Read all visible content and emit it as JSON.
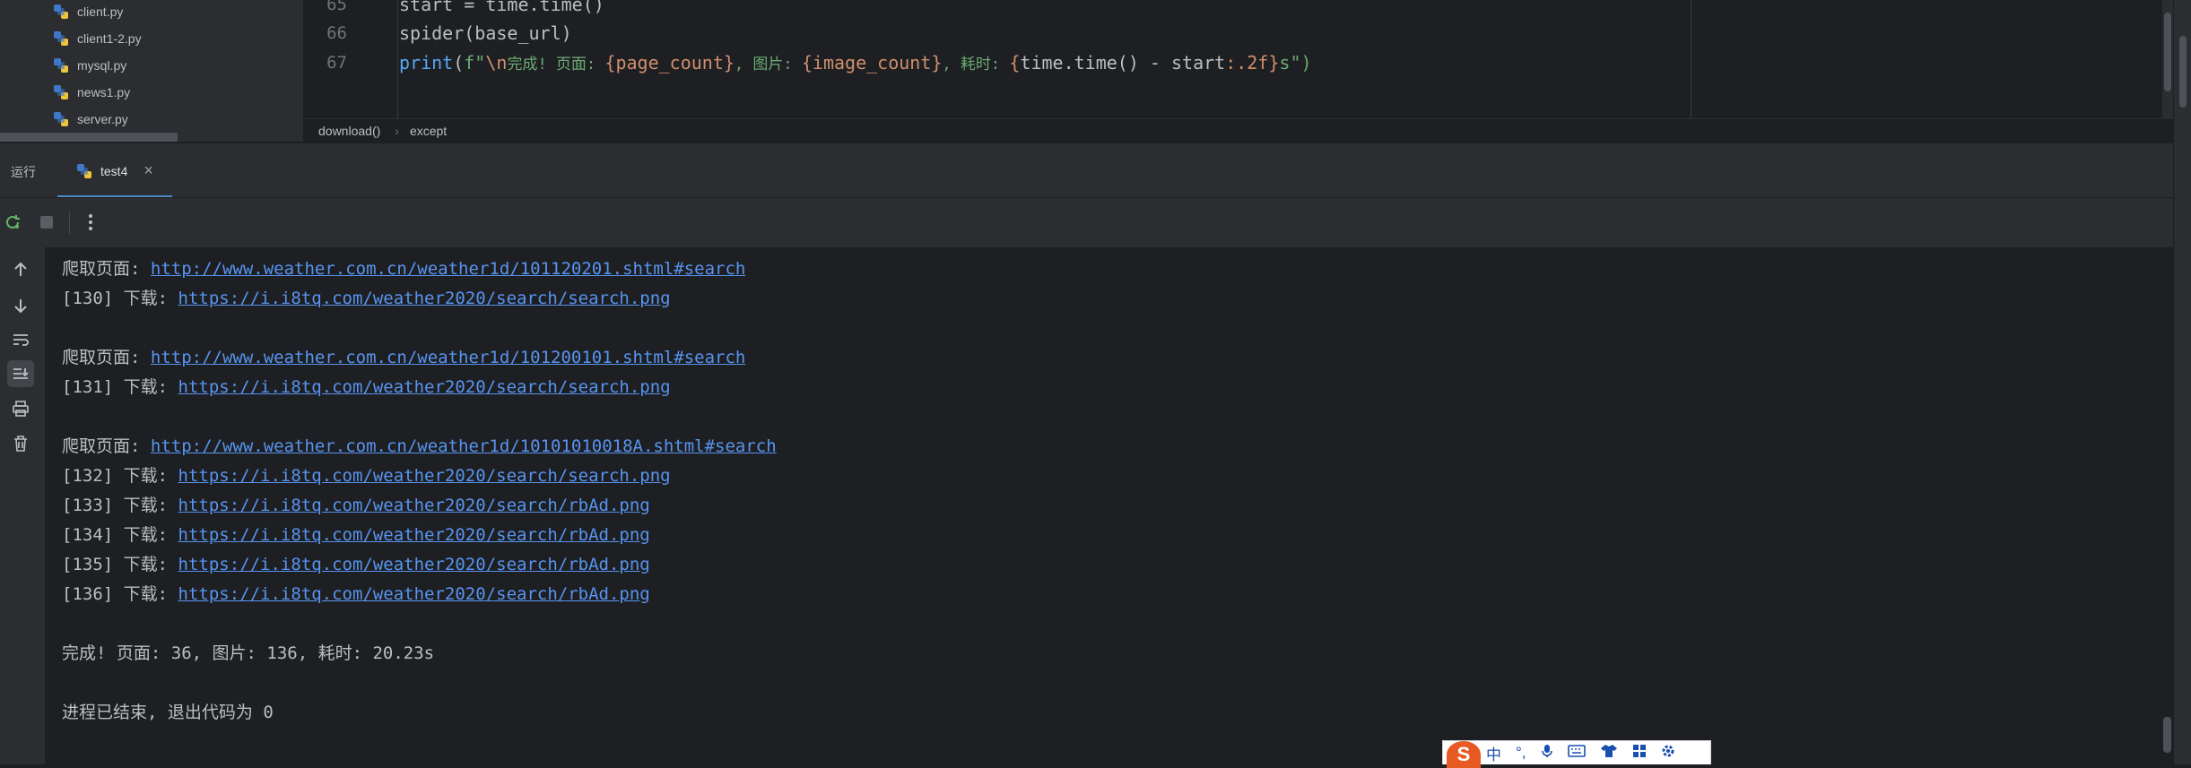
{
  "project_tree": {
    "files": [
      "client.py",
      "client1-2.py",
      "mysql.py",
      "news1.py",
      "server.py"
    ]
  },
  "editor": {
    "lines": [
      {
        "num": "65",
        "text": "start = time.time()"
      },
      {
        "num": "66",
        "text": "spider(base_url)"
      },
      {
        "num": "67",
        "print_kw": "print",
        "open": "(",
        "fstr_open": "f\"",
        "esc": "\\n",
        "msg1": "完成! 页面: ",
        "v1": "{page_count}",
        "msg2": ", 图片: ",
        "v2": "{image_count}",
        "msg3": ", 耗时: ",
        "v3a": "{",
        "v3b": "time.time() - start",
        "v3c": ":.2f}",
        "tail": "s\")"
      }
    ]
  },
  "breadcrumb": {
    "items": [
      "download()",
      "except"
    ]
  },
  "run_panel": {
    "label": "运行",
    "tab": "test4"
  },
  "console": {
    "lines": [
      {
        "prefix": "爬取页面: ",
        "url": "http://www.weather.com.cn/weather1d/101120201.shtml#search"
      },
      {
        "prefix": "[130] 下载: ",
        "url": "https://i.i8tq.com/weather2020/search/search.png"
      },
      {
        "prefix": "",
        "url": ""
      },
      {
        "prefix": "爬取页面: ",
        "url": "http://www.weather.com.cn/weather1d/101200101.shtml#search"
      },
      {
        "prefix": "[131] 下载: ",
        "url": "https://i.i8tq.com/weather2020/search/search.png"
      },
      {
        "prefix": "",
        "url": ""
      },
      {
        "prefix": "爬取页面: ",
        "url": "http://www.weather.com.cn/weather1d/10101010018A.shtml#search"
      },
      {
        "prefix": "[132] 下载: ",
        "url": "https://i.i8tq.com/weather2020/search/search.png"
      },
      {
        "prefix": "[133] 下载: ",
        "url": "https://i.i8tq.com/weather2020/search/rbAd.png"
      },
      {
        "prefix": "[134] 下载: ",
        "url": "https://i.i8tq.com/weather2020/search/rbAd.png"
      },
      {
        "prefix": "[135] 下载: ",
        "url": "https://i.i8tq.com/weather2020/search/rbAd.png"
      },
      {
        "prefix": "[136] 下载: ",
        "url": "https://i.i8tq.com/weather2020/search/rbAd.png"
      },
      {
        "prefix": "",
        "url": ""
      },
      {
        "prefix": "完成! 页面: 36, 图片: 136, 耗时: 20.23s",
        "url": ""
      },
      {
        "prefix": "",
        "url": ""
      },
      {
        "prefix": "进程已结束, 退出代码为 0",
        "url": ""
      }
    ]
  },
  "ime": {
    "logo": "S",
    "items": [
      "中",
      "·,",
      "mic-icon",
      "keyboard-icon",
      "shirt-icon",
      "grid-icon",
      "gear-icon"
    ],
    "mode_label": "中",
    "punct_label": "°,"
  },
  "colors": {
    "link": "#5794f0",
    "accent": "#4a88c7",
    "background": "#1e1f22",
    "panel": "#2b2d30"
  }
}
